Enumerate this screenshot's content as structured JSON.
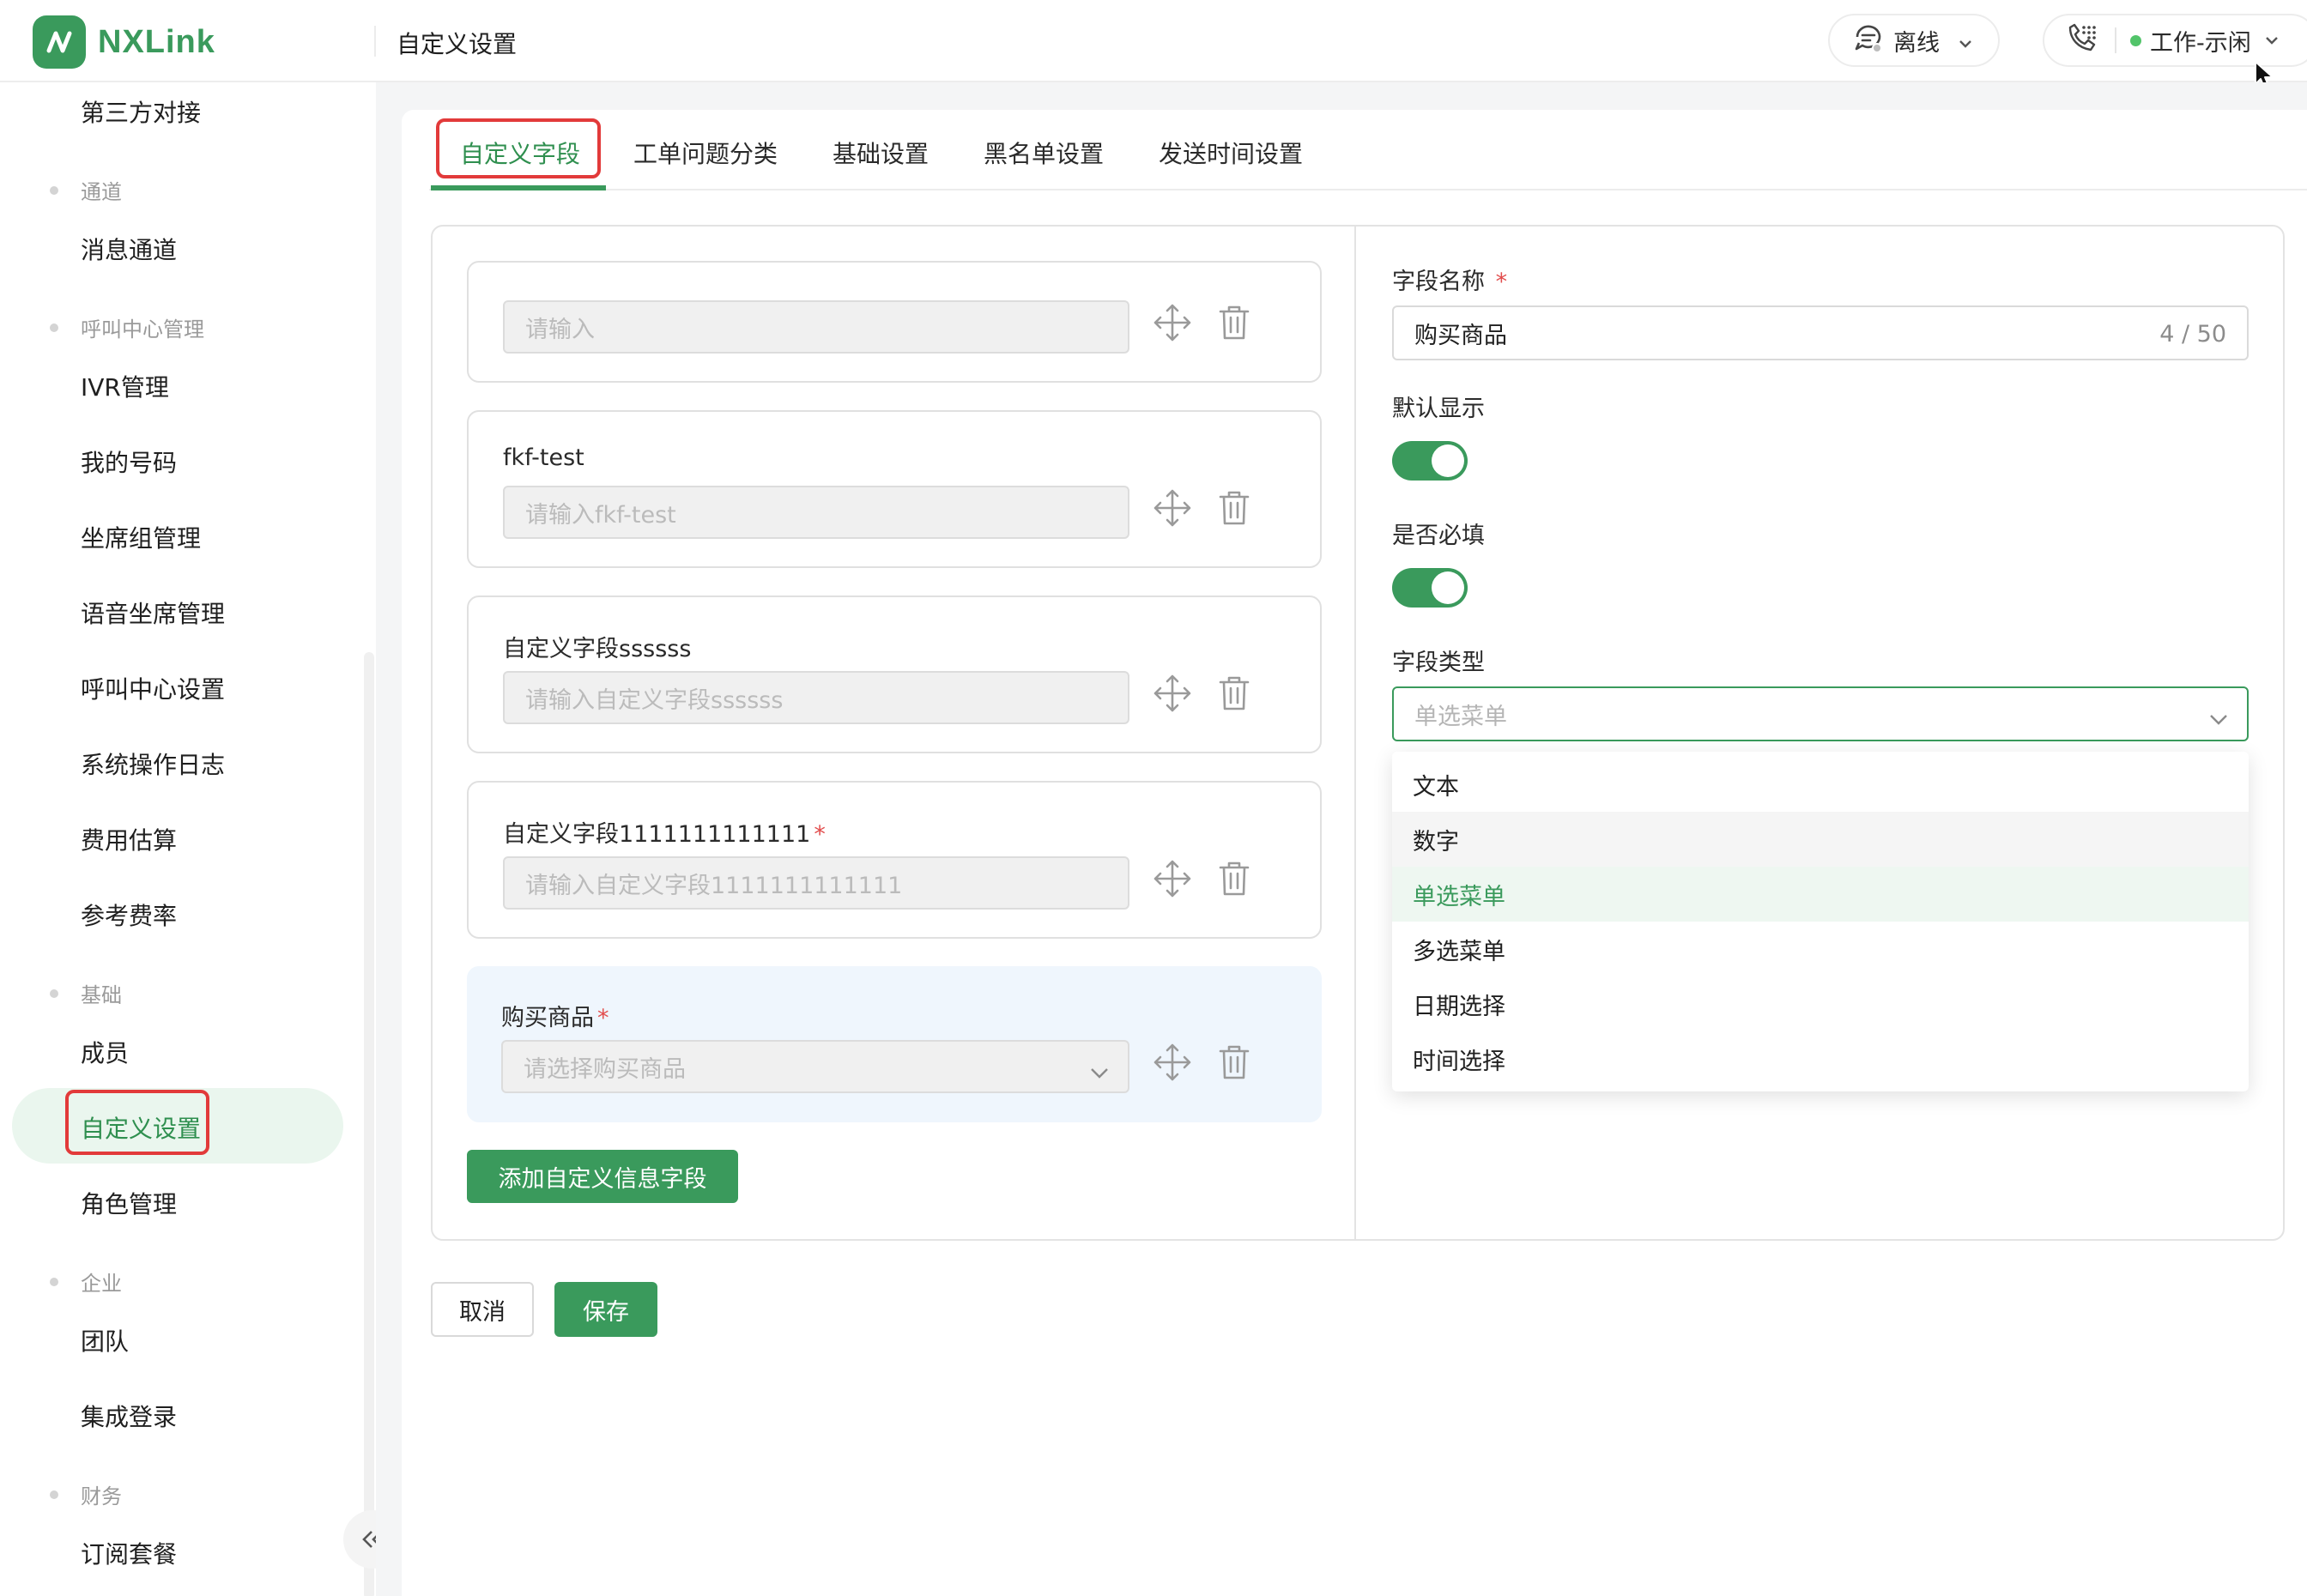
{
  "app": {
    "name": "NXLink",
    "page_title": "自定义设置"
  },
  "header": {
    "status_label": "离线",
    "work_status_label": "工作-示闲",
    "colors": {
      "online_dot": "#52c46a"
    }
  },
  "sidebar": {
    "top_item": "第三方对接",
    "groups": [
      {
        "title": "通道",
        "items": [
          "消息通道"
        ]
      },
      {
        "title": "呼叫中心管理",
        "items": [
          "IVR管理",
          "我的号码",
          "坐席组管理",
          "语音坐席管理",
          "呼叫中心设置",
          "系统操作日志",
          "费用估算",
          "参考费率"
        ]
      },
      {
        "title": "基础",
        "items": [
          "成员",
          "自定义设置",
          "角色管理"
        ]
      },
      {
        "title": "企业",
        "items": [
          "团队",
          "集成登录"
        ]
      },
      {
        "title": "财务",
        "items": [
          "订阅套餐"
        ]
      }
    ],
    "active_item": "自定义设置"
  },
  "tabs": [
    "自定义字段",
    "工单问题分类",
    "基础设置",
    "黑名单设置",
    "发送时间设置"
  ],
  "active_tab": "自定义字段",
  "fields": [
    {
      "label": "",
      "required": false,
      "placeholder": "请输入",
      "type": "input"
    },
    {
      "label": "fkf-test",
      "required": false,
      "placeholder": "请输入fkf-test",
      "type": "input"
    },
    {
      "label": "自定义字段ssssss",
      "required": false,
      "placeholder": "请输入自定义字段ssssss",
      "type": "input"
    },
    {
      "label": "自定义字段1111111111111",
      "required": true,
      "placeholder": "请输入自定义字段1111111111111",
      "type": "input"
    },
    {
      "label": "购买商品",
      "required": true,
      "placeholder": "请选择购买商品",
      "type": "select",
      "selected": true
    }
  ],
  "add_field_button": "添加自定义信息字段",
  "editor": {
    "name_label": "字段名称",
    "name_required_mark": "*",
    "name_value": "购买商品",
    "name_count": "4 / 50",
    "default_show_label": "默认显示",
    "default_show_on": true,
    "required_label": "是否必填",
    "required_on": true,
    "type_label": "字段类型",
    "type_placeholder": "单选菜单",
    "type_options": [
      "文本",
      "数字",
      "单选菜单",
      "多选菜单",
      "日期选择",
      "时间选择"
    ],
    "type_selected": "单选菜单",
    "type_hovered": "数字"
  },
  "footer": {
    "cancel": "取消",
    "save": "保存"
  },
  "theme": {
    "brand": "#3a9a5c",
    "danger": "#e24d4d",
    "annotation": "#e23a3a"
  }
}
